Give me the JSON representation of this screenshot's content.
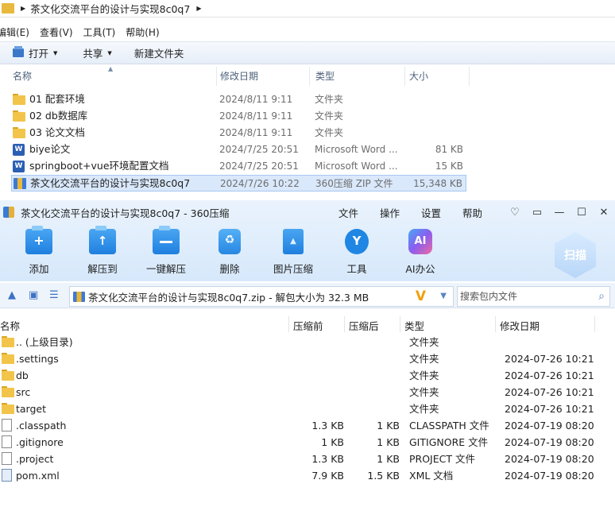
{
  "explorer": {
    "address_path": "茶文化交流平台的设计与实现8c0q7",
    "menu": [
      "编辑(E)",
      "查看(V)",
      "工具(T)",
      "帮助(H)"
    ],
    "toolbar": {
      "open_label": "打开",
      "share_label": "共享",
      "new_folder_label": "新建文件夹"
    },
    "columns": {
      "name": "名称",
      "date": "修改日期",
      "type": "类型",
      "size": "大小"
    },
    "rows": [
      {
        "name": "01 配套环境",
        "date": "2024/8/11 9:11",
        "type": "文件夹",
        "size": "",
        "icon": "folder-icon"
      },
      {
        "name": "02 db数据库",
        "date": "2024/8/11 9:11",
        "type": "文件夹",
        "size": "",
        "icon": "folder-icon"
      },
      {
        "name": "03 论文文档",
        "date": "2024/8/11 9:11",
        "type": "文件夹",
        "size": "",
        "icon": "folder-icon"
      },
      {
        "name": "biye论文",
        "date": "2024/7/25 20:51",
        "type": "Microsoft Word ...",
        "size": "81 KB",
        "icon": "word-icon"
      },
      {
        "name": "springboot+vue环境配置文档",
        "date": "2024/7/25 20:51",
        "type": "Microsoft Word ...",
        "size": "15 KB",
        "icon": "word-icon"
      },
      {
        "name": "茶文化交流平台的设计与实现8c0q7",
        "date": "2024/7/26 10:22",
        "type": "360压缩 ZIP 文件",
        "size": "15,348 KB",
        "icon": "zip-icon"
      }
    ]
  },
  "zipwin": {
    "title": "茶文化交流平台的设计与实现8c0q7 - 360压缩",
    "menu": [
      "文件",
      "操作",
      "设置",
      "帮助"
    ],
    "window_buttons": {
      "skin": "♡",
      "feedback": "▭",
      "minimize": "—",
      "maximize": "☐",
      "close": "✕"
    },
    "ribbon": [
      "添加",
      "解压到",
      "一键解压",
      "删除",
      "图片压缩",
      "工具",
      "AI办公"
    ],
    "scan_label": "扫描",
    "path_text": "茶文化交流平台的设计与实现8c0q7.zip - 解包大小为 32.3 MB",
    "search_placeholder": "搜索包内文件",
    "columns": {
      "name": "名称",
      "compressed_before": "压缩前",
      "compressed_after": "压缩后",
      "type": "类型",
      "date": "修改日期"
    },
    "rows": [
      {
        "name": ".. (上级目录)",
        "before": "",
        "after": "",
        "type": "文件夹",
        "date": "",
        "icon": "folder-icon"
      },
      {
        "name": ".settings",
        "before": "",
        "after": "",
        "type": "文件夹",
        "date": "2024-07-26 10:21",
        "icon": "folder-icon"
      },
      {
        "name": "db",
        "before": "",
        "after": "",
        "type": "文件夹",
        "date": "2024-07-26 10:21",
        "icon": "folder-icon"
      },
      {
        "name": "src",
        "before": "",
        "after": "",
        "type": "文件夹",
        "date": "2024-07-26 10:21",
        "icon": "folder-icon"
      },
      {
        "name": "target",
        "before": "",
        "after": "",
        "type": "文件夹",
        "date": "2024-07-26 10:21",
        "icon": "folder-icon"
      },
      {
        "name": ".classpath",
        "before": "1.3 KB",
        "after": "1 KB",
        "type": "CLASSPATH 文件",
        "date": "2024-07-19 08:20",
        "icon": "file-icon"
      },
      {
        "name": ".gitignore",
        "before": "1 KB",
        "after": "1 KB",
        "type": "GITIGNORE 文件",
        "date": "2024-07-19 08:20",
        "icon": "file-icon"
      },
      {
        "name": ".project",
        "before": "1.3 KB",
        "after": "1 KB",
        "type": "PROJECT 文件",
        "date": "2024-07-19 08:20",
        "icon": "file-icon"
      },
      {
        "name": "pom.xml",
        "before": "7.9 KB",
        "after": "1.5 KB",
        "type": "XML 文档",
        "date": "2024-07-19 08:20",
        "icon": "xml-file-icon"
      }
    ]
  }
}
